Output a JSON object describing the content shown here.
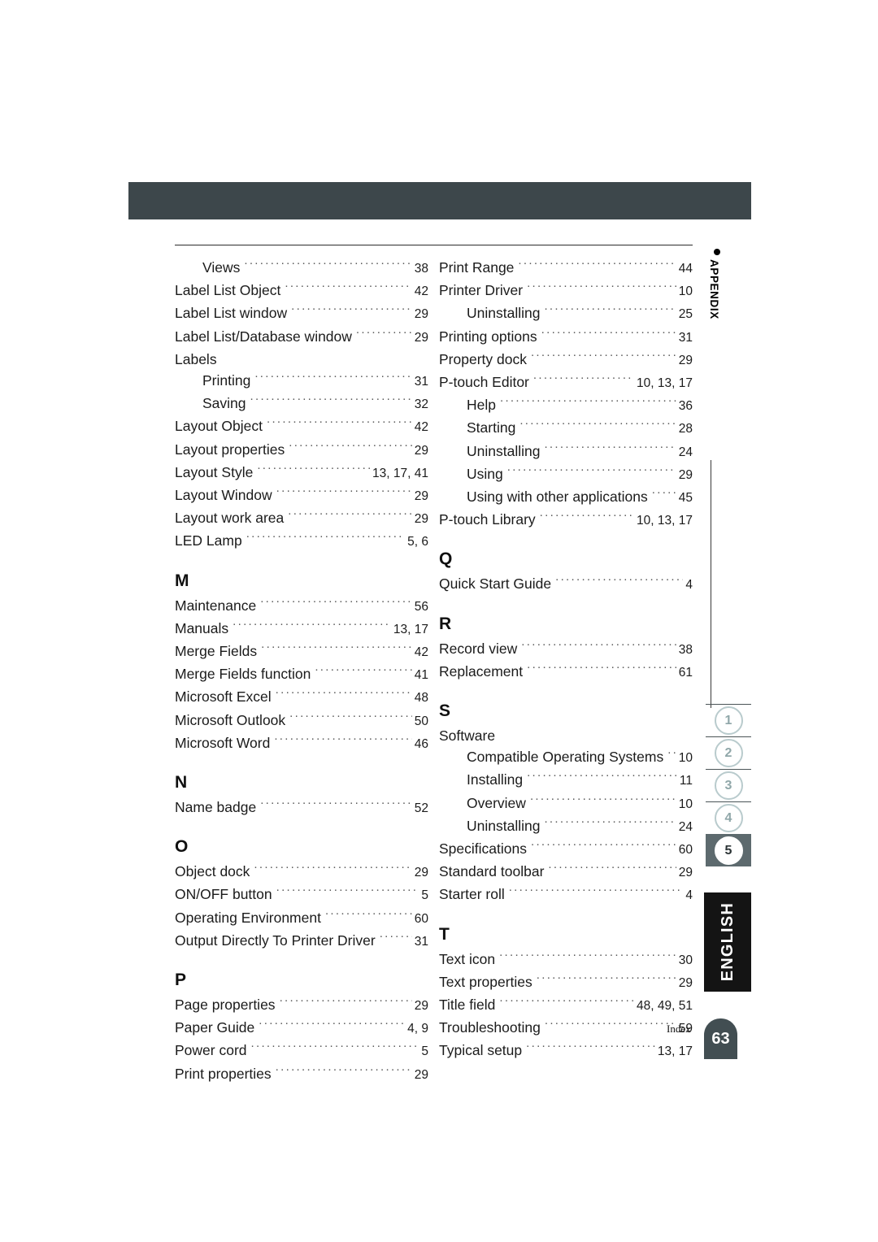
{
  "document": {
    "footer_label": "Index",
    "page_number": "63",
    "language_tab": "ENGLISH",
    "appendix_label": "APPENDIX",
    "header_bar_color": "#3d474b",
    "active_tab_color": "#5d6a6e",
    "page_tab_color": "#424e52"
  },
  "chapter_tabs": [
    {
      "number": "1",
      "active": false
    },
    {
      "number": "2",
      "active": false
    },
    {
      "number": "3",
      "active": false
    },
    {
      "number": "4",
      "active": false
    },
    {
      "number": "5",
      "active": true
    }
  ],
  "index": {
    "left_column": [
      {
        "kind": "entry",
        "sub": true,
        "label": "Views",
        "pages": "38"
      },
      {
        "kind": "entry",
        "sub": false,
        "label": "Label List Object",
        "pages": "42"
      },
      {
        "kind": "entry",
        "sub": false,
        "label": "Label List window",
        "pages": "29"
      },
      {
        "kind": "entry",
        "sub": false,
        "label": "Label List/Database window",
        "pages": "29"
      },
      {
        "kind": "entry",
        "sub": false,
        "label": "Labels",
        "pages": "",
        "noleader": true
      },
      {
        "kind": "entry",
        "sub": true,
        "label": "Printing",
        "pages": "31"
      },
      {
        "kind": "entry",
        "sub": true,
        "label": "Saving",
        "pages": "32"
      },
      {
        "kind": "entry",
        "sub": false,
        "label": "Layout Object",
        "pages": "42"
      },
      {
        "kind": "entry",
        "sub": false,
        "label": "Layout properties",
        "pages": "29"
      },
      {
        "kind": "entry",
        "sub": false,
        "label": "Layout Style",
        "pages": "13, 17, 41"
      },
      {
        "kind": "entry",
        "sub": false,
        "label": "Layout Window",
        "pages": "29"
      },
      {
        "kind": "entry",
        "sub": false,
        "label": "Layout work area",
        "pages": "29"
      },
      {
        "kind": "entry",
        "sub": false,
        "label": "LED Lamp",
        "pages": "5, 6"
      },
      {
        "kind": "letter",
        "label": "M"
      },
      {
        "kind": "entry",
        "sub": false,
        "label": "Maintenance",
        "pages": "56"
      },
      {
        "kind": "entry",
        "sub": false,
        "label": "Manuals",
        "pages": "13, 17"
      },
      {
        "kind": "entry",
        "sub": false,
        "label": "Merge Fields",
        "pages": "42"
      },
      {
        "kind": "entry",
        "sub": false,
        "label": "Merge Fields function",
        "pages": "41"
      },
      {
        "kind": "entry",
        "sub": false,
        "label": "Microsoft Excel",
        "pages": "48"
      },
      {
        "kind": "entry",
        "sub": false,
        "label": "Microsoft Outlook",
        "pages": "50"
      },
      {
        "kind": "entry",
        "sub": false,
        "label": "Microsoft Word",
        "pages": "46"
      },
      {
        "kind": "letter",
        "label": "N"
      },
      {
        "kind": "entry",
        "sub": false,
        "label": "Name badge",
        "pages": "52"
      },
      {
        "kind": "letter",
        "label": "O"
      },
      {
        "kind": "entry",
        "sub": false,
        "label": "Object dock",
        "pages": "29"
      },
      {
        "kind": "entry",
        "sub": false,
        "label": "ON/OFF button",
        "pages": "5"
      },
      {
        "kind": "entry",
        "sub": false,
        "label": "Operating Environment",
        "pages": "60"
      },
      {
        "kind": "entry",
        "sub": false,
        "label": "Output Directly To Printer Driver",
        "pages": "31"
      },
      {
        "kind": "letter",
        "label": "P"
      },
      {
        "kind": "entry",
        "sub": false,
        "label": "Page properties",
        "pages": "29"
      },
      {
        "kind": "entry",
        "sub": false,
        "label": "Paper Guide",
        "pages": "4, 9"
      },
      {
        "kind": "entry",
        "sub": false,
        "label": "Power cord",
        "pages": "5"
      },
      {
        "kind": "entry",
        "sub": false,
        "label": "Print properties",
        "pages": "29"
      }
    ],
    "right_column": [
      {
        "kind": "entry",
        "sub": false,
        "label": "Print Range",
        "pages": "44"
      },
      {
        "kind": "entry",
        "sub": false,
        "label": "Printer Driver",
        "pages": "10"
      },
      {
        "kind": "entry",
        "sub": true,
        "label": "Uninstalling",
        "pages": "25"
      },
      {
        "kind": "entry",
        "sub": false,
        "label": "Printing options",
        "pages": "31"
      },
      {
        "kind": "entry",
        "sub": false,
        "label": "Property dock",
        "pages": "29"
      },
      {
        "kind": "entry",
        "sub": false,
        "label": "P-touch Editor",
        "pages": "10, 13, 17"
      },
      {
        "kind": "entry",
        "sub": true,
        "label": "Help",
        "pages": "36"
      },
      {
        "kind": "entry",
        "sub": true,
        "label": "Starting",
        "pages": "28"
      },
      {
        "kind": "entry",
        "sub": true,
        "label": "Uninstalling",
        "pages": "24"
      },
      {
        "kind": "entry",
        "sub": true,
        "label": "Using",
        "pages": "29"
      },
      {
        "kind": "entry",
        "sub": true,
        "label": "Using with other applications",
        "pages": "45"
      },
      {
        "kind": "entry",
        "sub": false,
        "label": "P-touch Library",
        "pages": "10, 13, 17"
      },
      {
        "kind": "letter",
        "label": "Q"
      },
      {
        "kind": "entry",
        "sub": false,
        "label": "Quick Start Guide",
        "pages": "4"
      },
      {
        "kind": "letter",
        "label": "R"
      },
      {
        "kind": "entry",
        "sub": false,
        "label": "Record view",
        "pages": "38"
      },
      {
        "kind": "entry",
        "sub": false,
        "label": "Replacement",
        "pages": "61"
      },
      {
        "kind": "letter",
        "label": "S"
      },
      {
        "kind": "entry",
        "sub": false,
        "label": "Software",
        "pages": "",
        "noleader": true
      },
      {
        "kind": "entry",
        "sub": true,
        "label": "Compatible Operating Systems",
        "pages": "10"
      },
      {
        "kind": "entry",
        "sub": true,
        "label": "Installing",
        "pages": "11"
      },
      {
        "kind": "entry",
        "sub": true,
        "label": "Overview",
        "pages": "10"
      },
      {
        "kind": "entry",
        "sub": true,
        "label": "Uninstalling",
        "pages": "24"
      },
      {
        "kind": "entry",
        "sub": false,
        "label": "Specifications",
        "pages": "60"
      },
      {
        "kind": "entry",
        "sub": false,
        "label": "Standard toolbar",
        "pages": "29"
      },
      {
        "kind": "entry",
        "sub": false,
        "label": "Starter roll",
        "pages": "4"
      },
      {
        "kind": "letter",
        "label": "T"
      },
      {
        "kind": "entry",
        "sub": false,
        "label": "Text icon",
        "pages": "30"
      },
      {
        "kind": "entry",
        "sub": false,
        "label": "Text properties",
        "pages": "29"
      },
      {
        "kind": "entry",
        "sub": false,
        "label": "Title field",
        "pages": "48, 49, 51"
      },
      {
        "kind": "entry",
        "sub": false,
        "label": "Troubleshooting",
        "pages": "59"
      },
      {
        "kind": "entry",
        "sub": false,
        "label": "Typical setup",
        "pages": "13, 17"
      }
    ]
  }
}
